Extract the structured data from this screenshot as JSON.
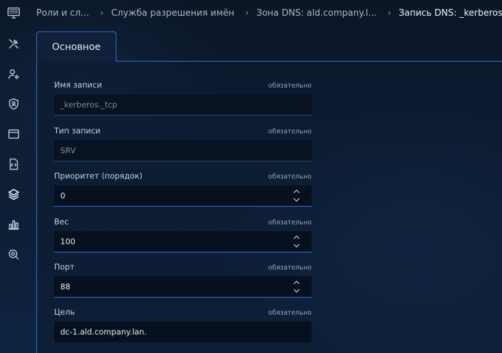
{
  "sidebar": {
    "logo": "monitor-logo",
    "items": [
      {
        "icon": "tools-icon"
      },
      {
        "icon": "user-settings-icon"
      },
      {
        "icon": "shield-user-icon"
      },
      {
        "icon": "browser-window-icon"
      },
      {
        "icon": "code-file-icon"
      },
      {
        "icon": "layers-icon"
      },
      {
        "icon": "bar-chart-icon"
      },
      {
        "icon": "search-scan-icon"
      }
    ]
  },
  "breadcrumb": [
    "Роли и сл...",
    "Служба разрешения имён",
    "Зона DNS: ald.company.l...",
    "Запись DNS: _kerberos._t..."
  ],
  "tabs": [
    {
      "label": "Основное"
    }
  ],
  "form": {
    "required_label": "обязательно",
    "fields": [
      {
        "label": "Имя записи",
        "value": "_kerberos._tcp"
      },
      {
        "label": "Тип записи",
        "value": "SRV"
      },
      {
        "label": "Приоритет (порядок)",
        "value": "0"
      },
      {
        "label": "Вес",
        "value": "100"
      },
      {
        "label": "Порт",
        "value": "88"
      },
      {
        "label": "Цель",
        "value": "dc-1.ald.company.lan."
      }
    ]
  },
  "colors": {
    "accent": "#2f6fd6",
    "background": "#0c1a2e"
  }
}
